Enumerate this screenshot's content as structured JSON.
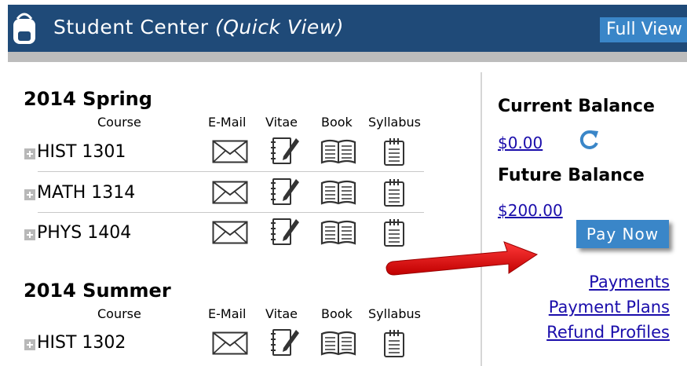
{
  "header": {
    "title": "Student Center",
    "subtitle": "(Quick View)",
    "full_view_label": "Full View"
  },
  "terms": [
    {
      "title": "2014 Spring",
      "columns": {
        "course": "Course",
        "email": "E-Mail",
        "vitae": "Vitae",
        "book": "Book",
        "syllabus": "Syllabus"
      },
      "courses": [
        "HIST 1301",
        "MATH 1314",
        "PHYS 1404"
      ]
    },
    {
      "title": "2014 Summer",
      "columns": {
        "course": "Course",
        "email": "E-Mail",
        "vitae": "Vitae",
        "book": "Book",
        "syllabus": "Syllabus"
      },
      "courses": [
        "HIST 1302"
      ]
    }
  ],
  "balance": {
    "current_label": "Current Balance",
    "current_value": "$0.00",
    "future_label": "Future Balance",
    "future_value": "$200.00",
    "pay_now_label": "Pay Now"
  },
  "links": {
    "payments": "Payments",
    "payment_plans": "Payment Plans",
    "refund_profiles": "Refund Profiles"
  },
  "icons": {
    "header": "backpack-icon",
    "email": "envelope-icon",
    "vitae": "notepad-pencil-icon",
    "book": "open-book-icon",
    "syllabus": "clipboard-icon",
    "expand": "plus-icon",
    "refresh": "refresh-icon"
  },
  "colors": {
    "header_bg": "#1f4a78",
    "button_bg": "#3a86c8",
    "link": "#1a0dab",
    "arrow": "#e01010"
  }
}
